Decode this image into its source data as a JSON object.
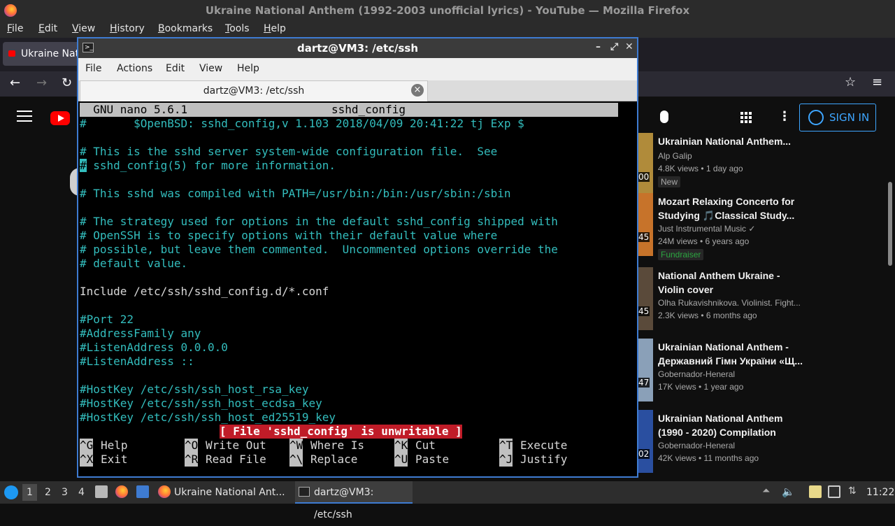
{
  "firefox": {
    "window_title": "Ukraine National Anthem (1992-2003 unofficial lyrics) - YouTube — Mozilla Firefox",
    "menu": [
      "File",
      "Edit",
      "View",
      "History",
      "Bookmarks",
      "Tools",
      "Help"
    ],
    "tab_title": "Ukraine National Anthem (1992-2003 unofficial lyrics) - YouTube"
  },
  "youtube": {
    "sign_in": "SIGN IN",
    "recommendations": [
      {
        "title": "Ukrainian National Anthem...",
        "channel": "Alp Galip",
        "meta": "4.8K views • 1 day ago",
        "badge": "New",
        "duration": "00",
        "thumb": "#b08b3a"
      },
      {
        "title": "Mozart Relaxing Concerto for Studying 🎵Classical Study...",
        "channel": "Just Instrumental Music ✓",
        "meta": "24M views • 6 years ago",
        "badge": "Fundraiser",
        "duration": "45",
        "thumb": "#c7732a"
      },
      {
        "title": "National Anthem Ukraine - Violin cover",
        "channel": "Olha Rukavishnikova. Violinist. Fight...",
        "meta": "2.3K views • 6 months ago",
        "badge": "",
        "duration": "45",
        "thumb": "#5a4a3a"
      },
      {
        "title": "Ukrainian National Anthem - Державний Гімн України «Щ...",
        "channel": "Gobernador-Heneral",
        "meta": "17K views • 1 year ago",
        "badge": "",
        "duration": "47",
        "thumb": "#8aa0b8"
      },
      {
        "title": "Ukrainian National Anthem (1990 - 2020) Compilation",
        "channel": "Gobernador-Heneral",
        "meta": "42K views • 11 months ago",
        "badge": "",
        "duration": "02",
        "thumb": "#2a4fa0"
      }
    ]
  },
  "terminal": {
    "window_title": "dartz@VM3: /etc/ssh",
    "tab_title": "dartz@VM3: /etc/ssh",
    "menu": [
      "File",
      "Actions",
      "Edit",
      "View",
      "Help"
    ],
    "nano_version": "  GNU nano 5.6.1",
    "nano_file": "sshd_config",
    "lines": [
      {
        "text": "#\t$OpenBSD: sshd_config,v 1.103 2018/04/09 20:41:22 tj Exp $",
        "type": "comment"
      },
      {
        "text": "",
        "type": "plain"
      },
      {
        "text": "# This is the sshd server system-wide configuration file.  See",
        "type": "comment"
      },
      {
        "text": "# sshd_config(5) for more information.",
        "type": "comment"
      },
      {
        "text": "",
        "type": "plain"
      },
      {
        "text": "# This sshd was compiled with PATH=/usr/bin:/bin:/usr/sbin:/sbin",
        "type": "comment"
      },
      {
        "text": "",
        "type": "plain"
      },
      {
        "text": "# The strategy used for options in the default sshd_config shipped with",
        "type": "comment"
      },
      {
        "text": "# OpenSSH is to specify options with their default value where",
        "type": "comment"
      },
      {
        "text": "# possible, but leave them commented.  Uncommented options override the",
        "type": "comment"
      },
      {
        "text": "# default value.",
        "type": "comment"
      },
      {
        "text": "",
        "type": "plain"
      },
      {
        "text": "Include /etc/ssh/sshd_config.d/*.conf",
        "type": "plain"
      },
      {
        "text": "",
        "type": "plain"
      },
      {
        "text": "#Port 22",
        "type": "comment"
      },
      {
        "text": "#AddressFamily any",
        "type": "comment"
      },
      {
        "text": "#ListenAddress 0.0.0.0",
        "type": "comment"
      },
      {
        "text": "#ListenAddress ::",
        "type": "comment"
      },
      {
        "text": "",
        "type": "plain"
      },
      {
        "text": "#HostKey /etc/ssh/ssh_host_rsa_key",
        "type": "comment"
      },
      {
        "text": "#HostKey /etc/ssh/ssh_host_ecdsa_key",
        "type": "comment"
      },
      {
        "text": "#HostKey /etc/ssh/ssh_host_ed25519_key",
        "type": "comment"
      }
    ],
    "status": "[ File 'sshd_config' is unwritable ]",
    "shortcuts": [
      {
        "key": "^G",
        "label": "Help"
      },
      {
        "key": "^O",
        "label": "Write Out"
      },
      {
        "key": "^W",
        "label": "Where Is"
      },
      {
        "key": "^K",
        "label": "Cut"
      },
      {
        "key": "^T",
        "label": "Execute"
      },
      {
        "key": "^X",
        "label": "Exit"
      },
      {
        "key": "^R",
        "label": "Read File"
      },
      {
        "key": "^\\",
        "label": "Replace"
      },
      {
        "key": "^U",
        "label": "Paste"
      },
      {
        "key": "^J",
        "label": "Justify"
      }
    ]
  },
  "taskbar": {
    "workspaces": [
      "1",
      "2",
      "3",
      "4"
    ],
    "tasks": [
      "Ukraine National Ant...",
      "dartz@VM3: /etc/ssh"
    ],
    "clock": "11:22"
  }
}
